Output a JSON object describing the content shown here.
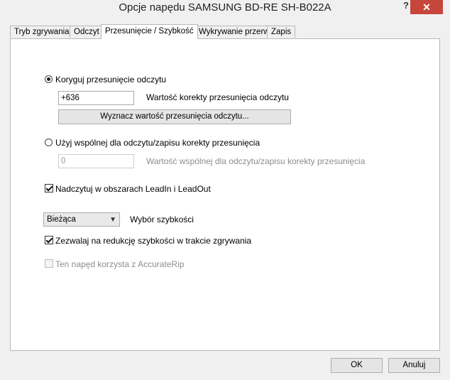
{
  "window": {
    "title": "Opcje napędu SAMSUNG BD-RE   SH-B022A",
    "help": "?",
    "close": "✕"
  },
  "tabs": [
    {
      "label": "Tryb zgrywania"
    },
    {
      "label": "Odczyt"
    },
    {
      "label": "Przesunięcie / Szybkość",
      "active": true
    },
    {
      "label": "Wykrywanie przerw"
    },
    {
      "label": "Zapis"
    }
  ],
  "offset": {
    "correct_label": "Koryguj przesunięcie odczytu",
    "correct_selected": true,
    "offset_value": "+636",
    "offset_value_label": "Wartość korekty przesunięcia odczytu",
    "detect_button": "Wyznacz wartość przesunięcia odczytu...",
    "common_label": "Użyj wspólnej dla odczytu/zapisu korekty przesunięcia",
    "common_selected": false,
    "common_value": "0",
    "common_value_label": "Wartość wspólnej dla odczytu/zapisu korekty przesunięcia"
  },
  "overread": {
    "label": "Nadczytuj w obszarach LeadIn i LeadOut",
    "checked": true
  },
  "speed": {
    "selected": "Bieżąca",
    "label": "Wybór szybkości",
    "reduce_label": "Zezwalaj na redukcję szybkości w trakcie zgrywania",
    "reduce_checked": true
  },
  "accuraterip": {
    "label": "Ten napęd korzysta z AccurateRip",
    "checked": false
  },
  "footer": {
    "ok": "OK",
    "cancel": "Anuluj"
  },
  "colors": {
    "close": "#c7463c",
    "background": "#f0f0f0"
  }
}
